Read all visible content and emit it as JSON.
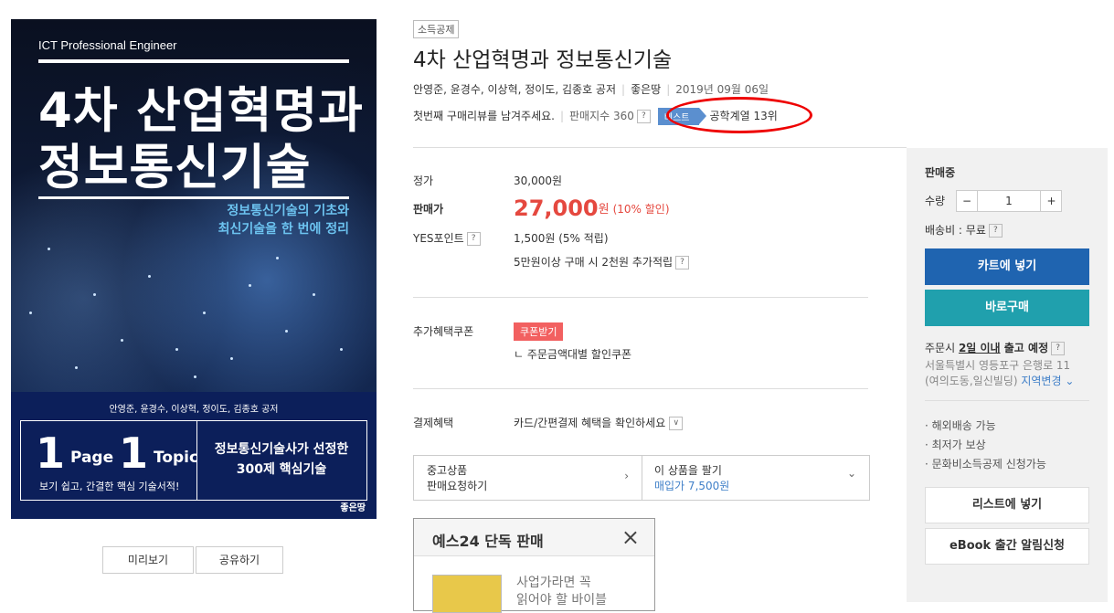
{
  "cover": {
    "subtitle": "ICT Professional Engineer",
    "title_line1": "4차 산업혁명과",
    "title_line2": "정보통신기술",
    "desc_line1": "정보통신기술의 기초와",
    "desc_line2": "최신기술을 한 번에 정리",
    "authors": "안영준, 윤경수, 이상혁, 정이도, 김종호 공저",
    "one": "1",
    "page": "Page",
    "topic": "Topic",
    "left_sub": "보기 쉽고, 간결한 핵심 기술서적!",
    "right_line1": "정보통신기술사가 선정한",
    "right_line2": "300제 핵심기술",
    "publisher_logo": "좋은땅"
  },
  "cover_buttons": {
    "preview": "미리보기",
    "share": "공유하기"
  },
  "product": {
    "tag": "소득공제",
    "title": "4차 산업혁명과 정보통신기술",
    "authors": "안영준, 윤경수, 이상혁, 정이도, 김종호 공저",
    "publisher": "좋은땅",
    "date": "2019년 09월 06일",
    "review_prompt": "첫번째 구매리뷰를 남겨주세요.",
    "sales_index": "판매지수 360",
    "help": "?",
    "best_label": "베스트",
    "best_rank": "공학계열 13위"
  },
  "price": {
    "list_label": "정가",
    "list_value": "30,000원",
    "sale_label": "판매가",
    "sale_value": "27,000",
    "sale_unit": "원",
    "discount": "(10% 할인)",
    "points_label": "YES포인트",
    "points_value": "1,500원 (5% 적립)",
    "points_extra": "5만원이상 구매 시 2천원 추가적립",
    "coupon_label": "추가혜택쿠폰",
    "coupon_btn": "쿠폰받기",
    "coupon_detail": "ㄴ 주문금액대별 할인쿠폰",
    "pay_label": "결제혜택",
    "pay_value": "카드/간편결제 혜택을 확인하세요",
    "pay_dropdown": "∨"
  },
  "sell": {
    "used_line1": "중고상품",
    "used_line2": "판매요청하기",
    "sell_line1": "이 상품을 팔기",
    "sell_line2": "매입가 7,500원",
    "arrow_right": "›",
    "arrow_down": "⌄"
  },
  "popup": {
    "title": "예스24 단독 판매",
    "close": "×",
    "text_line1": "사업가라면 꼭",
    "text_line2": "읽어야 할 바이블"
  },
  "panel": {
    "status": "판매중",
    "qty_label": "수량",
    "qty_minus": "−",
    "qty_value": "1",
    "qty_plus": "+",
    "shipping": "배송비 : 무료",
    "cart": "카트에 넣기",
    "buy_now": "바로구매",
    "order_prefix": "주문시 ",
    "order_days": "2일 이내",
    "order_suffix": " 출고 예정",
    "addr_line1": "서울특별시 영등포구 은행로 11",
    "addr_line2": "(여의도동,일신빌딩)",
    "addr_change": "지역변경",
    "b1": "· 해외배송 가능",
    "b2": "· 최저가 보상",
    "b3": "· 문화비소득공제 신청가능",
    "wishlist": "리스트에 넣기",
    "ebook": "eBook 출간 알림신청"
  },
  "colors": {
    "cart": "#1f64b0",
    "buy": "#20a0ad",
    "price": "#e5483f",
    "best": "#5b8fcf",
    "highlight": "#e00000"
  }
}
